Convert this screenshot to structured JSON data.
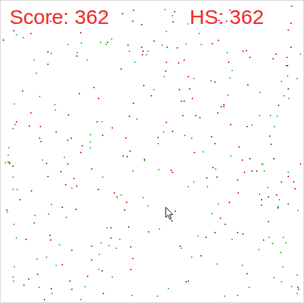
{
  "hud": {
    "score": "Score: 362",
    "high_score": "HS: 362"
  },
  "particles": [
    {
      "kind": "red",
      "color": "#c83232",
      "count": 190
    },
    {
      "kind": "green",
      "color": "#3cc83c",
      "count": 150
    }
  ]
}
